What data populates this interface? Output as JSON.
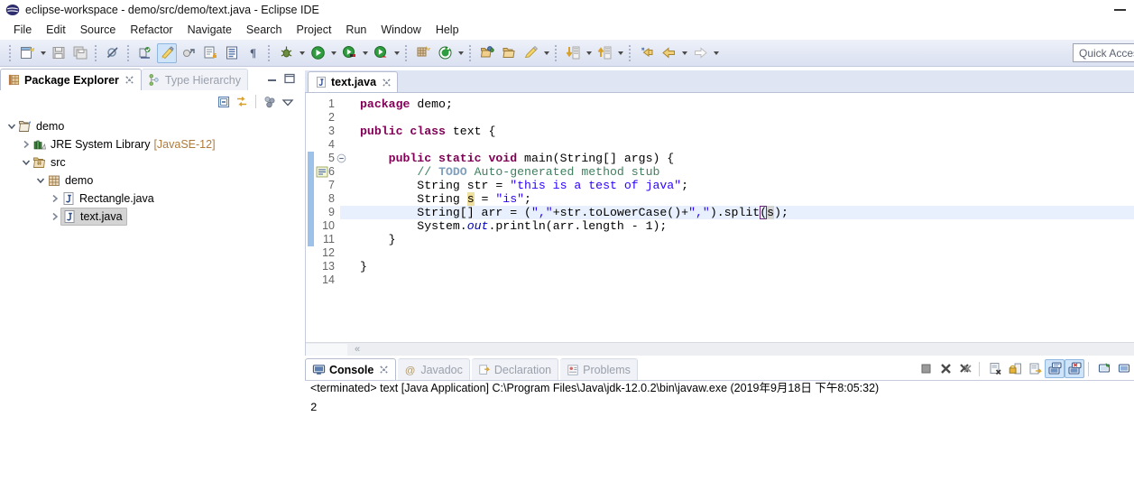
{
  "window": {
    "title": "eclipse-workspace - demo/src/demo/text.java - Eclipse IDE",
    "app_icon": "eclipse-icon",
    "minimize_label": "—"
  },
  "menubar": {
    "items": [
      {
        "label": "File"
      },
      {
        "label": "Edit"
      },
      {
        "label": "Source"
      },
      {
        "label": "Refactor"
      },
      {
        "label": "Navigate"
      },
      {
        "label": "Search"
      },
      {
        "label": "Project"
      },
      {
        "label": "Run"
      },
      {
        "label": "Window"
      },
      {
        "label": "Help"
      }
    ]
  },
  "toolbar": {
    "quick_access_placeholder": "Quick Access",
    "groups": [
      {
        "buttons": [
          {
            "icon": "new-wizard-icon",
            "has_dropdown": true
          },
          {
            "icon": "save-icon",
            "has_dropdown": false
          },
          {
            "icon": "save-all-icon",
            "has_dropdown": false
          }
        ]
      },
      {
        "buttons": [
          {
            "icon": "toggle-breakpoint-disabled-icon",
            "has_dropdown": false
          }
        ]
      },
      {
        "buttons": [
          {
            "icon": "new-java-project-icon",
            "has_dropdown": false
          },
          {
            "icon": "toggle-mark-occurrences-icon",
            "has_dropdown": false,
            "active": true
          },
          {
            "icon": "skip-breakpoints-icon",
            "has_dropdown": false
          },
          {
            "icon": "new-java-class-icon",
            "has_dropdown": false
          },
          {
            "icon": "open-task-icon",
            "has_dropdown": false
          },
          {
            "icon": "pilcrow-icon",
            "has_dropdown": false
          }
        ]
      },
      {
        "buttons": [
          {
            "icon": "debug-icon",
            "has_dropdown": true
          },
          {
            "icon": "run-icon",
            "has_dropdown": true
          },
          {
            "icon": "run-last-tool-icon",
            "has_dropdown": true
          },
          {
            "icon": "coverage-icon",
            "has_dropdown": true
          }
        ]
      },
      {
        "buttons": [
          {
            "icon": "new-package-icon",
            "has_dropdown": false
          },
          {
            "icon": "external-tools-icon",
            "has_dropdown": true
          }
        ]
      },
      {
        "buttons": [
          {
            "icon": "open-type-icon",
            "has_dropdown": false
          },
          {
            "icon": "open-task-folder-icon",
            "has_dropdown": false
          },
          {
            "icon": "search-pencil-icon",
            "has_dropdown": true
          }
        ]
      },
      {
        "buttons": [
          {
            "icon": "next-annotation-icon",
            "has_dropdown": true
          },
          {
            "icon": "previous-annotation-icon",
            "has_dropdown": true
          }
        ]
      },
      {
        "buttons": [
          {
            "icon": "last-edit-location-icon",
            "has_dropdown": false
          },
          {
            "icon": "back-icon",
            "has_dropdown": true
          },
          {
            "icon": "forward-icon",
            "has_dropdown": true
          }
        ]
      }
    ]
  },
  "package_explorer": {
    "tabs": [
      {
        "label": "Package Explorer",
        "icon": "package-explorer-icon",
        "selected": true,
        "closable": true
      },
      {
        "label": "Type Hierarchy",
        "icon": "type-hierarchy-icon",
        "selected": false,
        "closable": false
      }
    ],
    "view_buttons": [
      {
        "icon": "minimize-view-icon"
      },
      {
        "icon": "maximize-view-icon"
      }
    ],
    "toolbar_buttons": [
      {
        "icon": "collapse-all-icon"
      },
      {
        "icon": "link-with-editor-icon"
      },
      {
        "icon": "focus-on-active-task-icon"
      },
      {
        "icon": "view-menu-icon"
      }
    ],
    "tree": [
      {
        "label": "demo",
        "icon": "java-project-icon",
        "indent": 0,
        "expanded": true,
        "twisty": "down",
        "selected": false,
        "suffix": ""
      },
      {
        "label": "JRE System Library",
        "icon": "jre-library-icon",
        "indent": 1,
        "expanded": false,
        "twisty": "right",
        "selected": false,
        "suffix": "[JavaSE-12]"
      },
      {
        "label": "src",
        "icon": "source-folder-icon",
        "indent": 1,
        "expanded": true,
        "twisty": "down",
        "selected": false,
        "suffix": ""
      },
      {
        "label": "demo",
        "icon": "package-icon",
        "indent": 2,
        "expanded": true,
        "twisty": "down",
        "selected": false,
        "suffix": ""
      },
      {
        "label": "Rectangle.java",
        "icon": "java-file-icon",
        "indent": 3,
        "expanded": false,
        "twisty": "right",
        "selected": false,
        "suffix": ""
      },
      {
        "label": "text.java",
        "icon": "java-file-icon",
        "indent": 3,
        "expanded": false,
        "twisty": "right",
        "selected": true,
        "suffix": ""
      }
    ]
  },
  "editor": {
    "tabs": [
      {
        "label": "text.java",
        "icon": "java-file-icon",
        "selected": true,
        "closable": true
      }
    ],
    "scroll_hint": "«",
    "lines": [
      {
        "number": "1",
        "fold": false,
        "changed": false,
        "highlight": false,
        "marker": "",
        "tokens": [
          {
            "t": "package ",
            "c": "k"
          },
          {
            "t": "demo;",
            "c": "p"
          }
        ]
      },
      {
        "number": "2",
        "fold": false,
        "changed": false,
        "highlight": false,
        "marker": "",
        "tokens": []
      },
      {
        "number": "3",
        "fold": false,
        "changed": false,
        "highlight": false,
        "marker": "",
        "tokens": [
          {
            "t": "public class ",
            "c": "k"
          },
          {
            "t": "text {",
            "c": "p"
          }
        ]
      },
      {
        "number": "4",
        "fold": false,
        "changed": false,
        "highlight": false,
        "marker": "",
        "tokens": []
      },
      {
        "number": "5",
        "fold": true,
        "changed": true,
        "highlight": false,
        "marker": "",
        "tokens": [
          {
            "t": "    ",
            "c": "p"
          },
          {
            "t": "public static void ",
            "c": "k"
          },
          {
            "t": "main(String[] args) {",
            "c": "p"
          }
        ]
      },
      {
        "number": "6",
        "fold": false,
        "changed": true,
        "highlight": false,
        "marker": "todo-task-icon",
        "tokens": [
          {
            "t": "        ",
            "c": "p"
          },
          {
            "t": "// ",
            "c": "c"
          },
          {
            "t": "TODO",
            "c": "t"
          },
          {
            "t": " Auto-generated method stub",
            "c": "c"
          }
        ]
      },
      {
        "number": "7",
        "fold": false,
        "changed": true,
        "highlight": false,
        "marker": "",
        "tokens": [
          {
            "t": "        String str = ",
            "c": "p"
          },
          {
            "t": "\"this is a test of java\"",
            "c": "s"
          },
          {
            "t": ";",
            "c": "p"
          }
        ]
      },
      {
        "number": "8",
        "fold": false,
        "changed": true,
        "highlight": false,
        "marker": "",
        "tokens": [
          {
            "t": "        String ",
            "c": "p"
          },
          {
            "t": "s",
            "c": "p occ-write"
          },
          {
            "t": " = ",
            "c": "p"
          },
          {
            "t": "\"is\"",
            "c": "s"
          },
          {
            "t": ";",
            "c": "p"
          }
        ]
      },
      {
        "number": "9",
        "fold": false,
        "changed": true,
        "highlight": true,
        "marker": "",
        "tokens": [
          {
            "t": "        String[] arr = (",
            "c": "p"
          },
          {
            "t": "\",\"",
            "c": "s"
          },
          {
            "t": "+str.toLowerCase()+",
            "c": "p"
          },
          {
            "t": "\",\"",
            "c": "s"
          },
          {
            "t": ").split",
            "c": "p"
          },
          {
            "t": "(",
            "c": "p bracket"
          },
          {
            "t": "s",
            "c": "p occ-read"
          },
          {
            "t": ");",
            "c": "p"
          }
        ]
      },
      {
        "number": "10",
        "fold": false,
        "changed": true,
        "highlight": false,
        "marker": "",
        "tokens": [
          {
            "t": "        System.",
            "c": "p"
          },
          {
            "t": "out",
            "c": "f"
          },
          {
            "t": ".println(arr.length - ",
            "c": "p"
          },
          {
            "t": "1",
            "c": "p"
          },
          {
            "t": ");",
            "c": "p"
          }
        ]
      },
      {
        "number": "11",
        "fold": false,
        "changed": true,
        "highlight": false,
        "marker": "",
        "tokens": [
          {
            "t": "    }",
            "c": "p"
          }
        ]
      },
      {
        "number": "12",
        "fold": false,
        "changed": false,
        "highlight": false,
        "marker": "",
        "tokens": []
      },
      {
        "number": "13",
        "fold": false,
        "changed": false,
        "highlight": false,
        "marker": "",
        "tokens": [
          {
            "t": "}",
            "c": "p"
          }
        ]
      },
      {
        "number": "14",
        "fold": false,
        "changed": false,
        "highlight": false,
        "marker": "",
        "tokens": []
      }
    ]
  },
  "console": {
    "tabs": [
      {
        "label": "Console",
        "icon": "console-icon",
        "selected": true,
        "closable": true
      },
      {
        "label": "Javadoc",
        "icon": "javadoc-icon",
        "selected": false,
        "closable": false
      },
      {
        "label": "Declaration",
        "icon": "declaration-icon",
        "selected": false,
        "closable": false
      },
      {
        "label": "Problems",
        "icon": "problems-icon",
        "selected": false,
        "closable": false
      }
    ],
    "toolbar_buttons": [
      {
        "icon": "terminate-icon"
      },
      {
        "icon": "remove-launch-icon"
      },
      {
        "icon": "remove-all-terminated-icon"
      },
      {
        "icon": "clear-console-icon"
      },
      {
        "icon": "scroll-lock-icon"
      },
      {
        "icon": "pin-console-icon"
      },
      {
        "icon": "display-selected-console-icon",
        "active": true
      },
      {
        "icon": "open-console-icon",
        "active": true
      },
      {
        "icon": "new-console-view-icon"
      },
      {
        "icon": "console-menu-icon"
      }
    ],
    "header_line": "<terminated> text [Java Application] C:\\Program Files\\Java\\jdk-12.0.2\\bin\\javaw.exe (2019年9月18日 下午8:05:32)",
    "output": "2"
  },
  "colors": {
    "keyword": "#7f0055",
    "string": "#2a00ff",
    "comment": "#3f7f5f",
    "todo_tag": "#7f9fbf",
    "static_field": "#0000c0",
    "line_highlight": "#e8f0fe",
    "write_occurrence": "#f0e0a0",
    "read_occurrence": "#d4d4d4",
    "toolbar_bg": "#e2e7f4",
    "selection": "#d4d4d4"
  }
}
